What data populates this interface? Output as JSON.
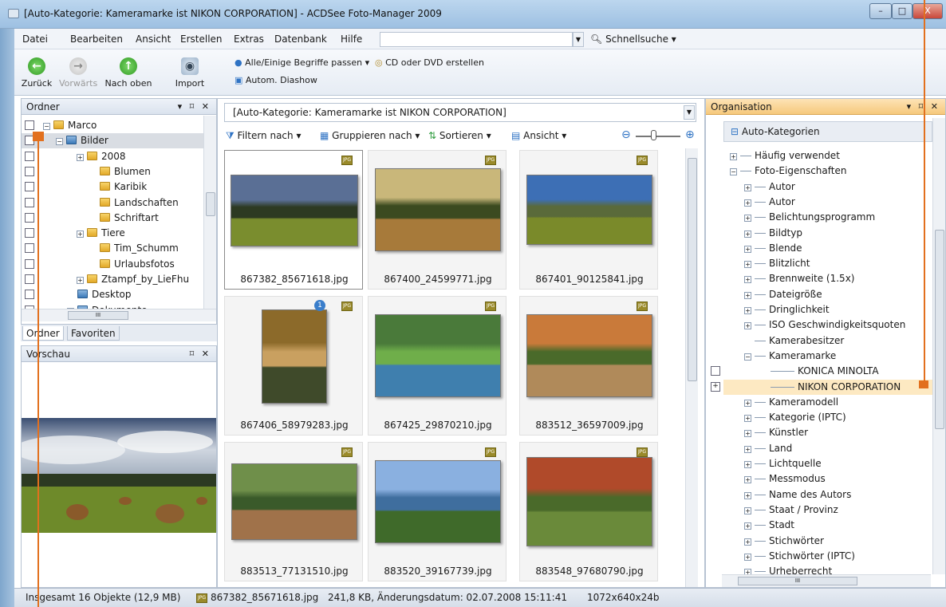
{
  "window": {
    "title": "[Auto-Kategorie: Kameramarke ist NIKON CORPORATION] - ACDSee Foto-Manager 2009",
    "minimize": "–",
    "maximize": "□",
    "close": "X"
  },
  "menu": {
    "items": [
      "Datei",
      "Bearbeiten",
      "Ansicht",
      "Erstellen",
      "Extras",
      "Datenbank",
      "Hilfe"
    ],
    "quicksearch": "Schnellsuche"
  },
  "toolbar": {
    "back": "Zurück",
    "forward": "Vorwärts",
    "up": "Nach oben",
    "import": "Import",
    "match_terms": "Alle/Einige Begriffe passen",
    "burn": "CD oder DVD erstellen",
    "slideshow": "Autom. Diashow"
  },
  "folders_panel": {
    "title": "Ordner",
    "controls": "▾ ⌑ ✕",
    "items": [
      "Marco",
      "Bilder",
      "2008",
      "Blumen",
      "Karibik",
      "Landschaften",
      "Schriftart",
      "Tiere",
      "Tim_Schumm",
      "Urlaubsfotos",
      "Ztampf_by_LieFhu",
      "Desktop",
      "Dokumente"
    ],
    "tabs": [
      "Ordner",
      "Favoriten"
    ],
    "hscroll_label": "III"
  },
  "preview_panel": {
    "title": "Vorschau",
    "controls": "⌑ ✕"
  },
  "browser": {
    "path": "[Auto-Kategorie: Kameramarke ist NIKON CORPORATION]",
    "filter": "Filtern nach",
    "group": "Gruppieren nach",
    "sort": "Sortieren",
    "view": "Ansicht",
    "jpg_badge": "JPG",
    "info_badge": "1",
    "files": [
      "867382_85671618.jpg",
      "867400_24599771.jpg",
      "867401_90125841.jpg",
      "867406_58979283.jpg",
      "867425_29870210.jpg",
      "883512_36597009.jpg",
      "883513_77131510.jpg",
      "883520_39167739.jpg",
      "883548_97680790.jpg"
    ]
  },
  "organizer": {
    "title": "Organisation",
    "controls": "▾ ⌑ ✕",
    "root": "Auto-Kategorien",
    "items": [
      "Häufig verwendet",
      "Foto-Eigenschaften",
      "Autor",
      "Autor",
      "Belichtungsprogramm",
      "Bildtyp",
      "Blende",
      "Blitzlicht",
      "Brennweite (1.5x)",
      "Dateigröße",
      "Dringlichkeit",
      "ISO Geschwindigkeitsquoten",
      "Kamerabesitzer",
      "Kameramarke",
      "KONICA MINOLTA",
      "NIKON CORPORATION",
      "Kameramodell",
      "Kategorie (IPTC)",
      "Künstler",
      "Land",
      "Lichtquelle",
      "Messmodus",
      "Name des Autors",
      "Staat / Provinz",
      "Stadt",
      "Stichwörter",
      "Stichwörter (IPTC)",
      "Urheberrecht"
    ],
    "hscroll_label": "III"
  },
  "status": {
    "total": "Insgesamt 16 Objekte  (12,9 MB)",
    "file": "867382_85671618.jpg",
    "details": "241,8 KB, Änderungsdatum: 02.07.2008 15:11:41",
    "dims": "1072x640x24b"
  },
  "colors": {
    "accent": "#e2701e",
    "selection": "#fde9c2",
    "title_bar": "#a8c8e8"
  }
}
